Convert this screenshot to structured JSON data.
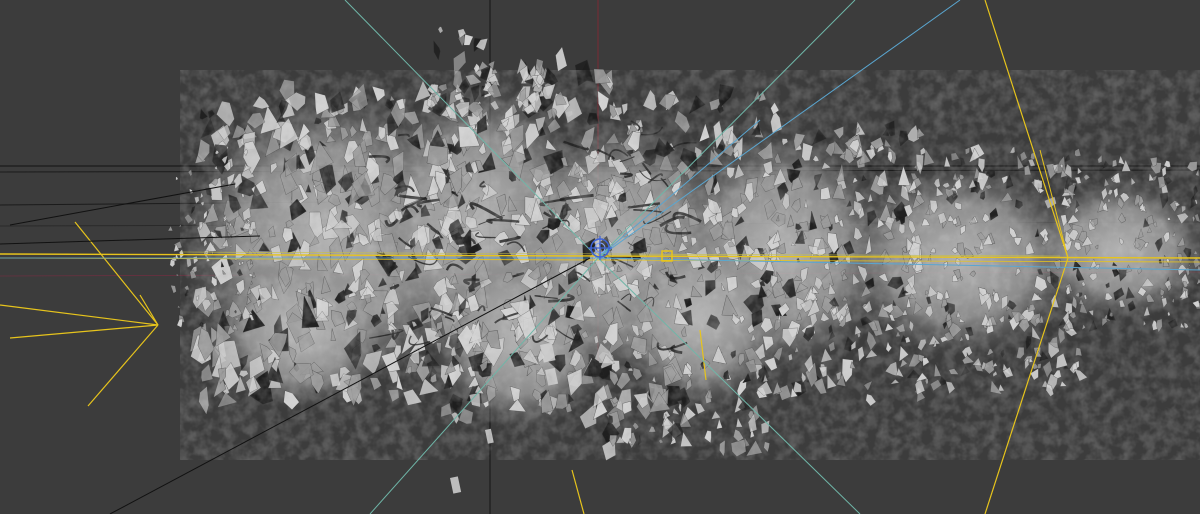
{
  "viewport": {
    "background_color": "#3c3c3c",
    "grid_line_color": "#1b1b1b",
    "vertical_axis_color": "#7a2a34",
    "camera_wire_color": "#e7c41c",
    "light_wire_color": "#5aa6d0",
    "teal_wire_color": "#6fb6a8",
    "mesh_light_color": "#d4d4d4",
    "mesh_mid_color": "#9a9a9a",
    "mesh_dark_color": "#1e1e1e",
    "selection_gizmo_color": "#3e63d8",
    "scene_object": "sculpted-mesh-cluster"
  }
}
